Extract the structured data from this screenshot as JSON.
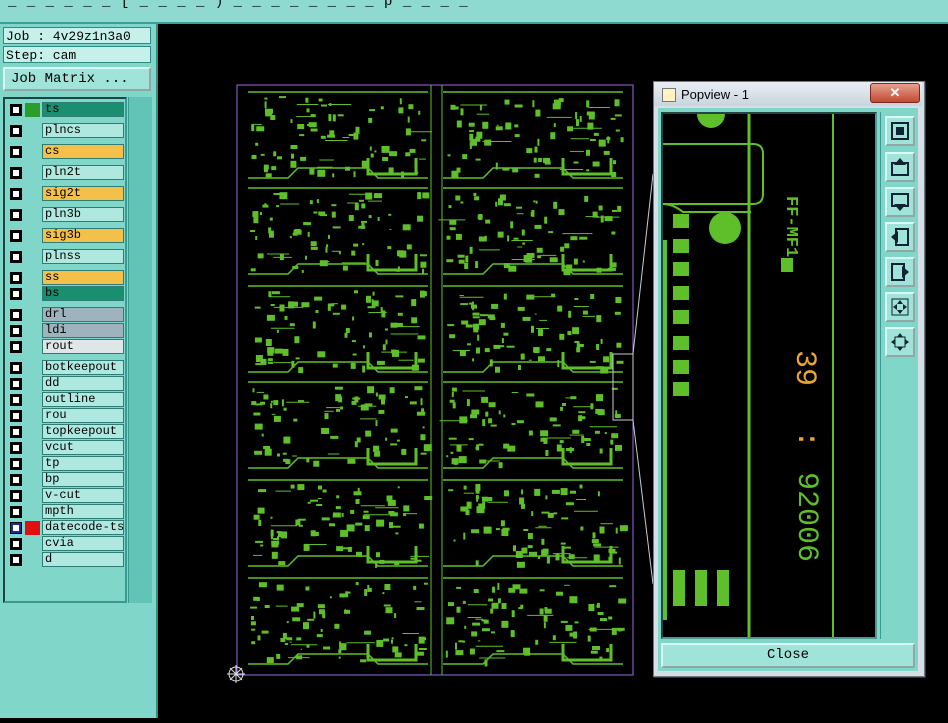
{
  "window": {
    "title": "_ _ _ _ _ _ [ _ _ _ _ ) _ _ _ _ _ _ _ _ p _ _ _ _"
  },
  "job": {
    "job_label": "Job : 4v29z1n3a0",
    "step_label": "Step: cam",
    "matrix_button": "Job Matrix ..."
  },
  "layers": [
    {
      "name": "ts",
      "color": "#1a8f70",
      "swatch": "#2a9d2a",
      "checked": true
    },
    {
      "name": "plncs",
      "color": "#aee8df"
    },
    {
      "name": "cs",
      "color": "#f4c04a"
    },
    {
      "name": "pln2t",
      "color": "#aee8df"
    },
    {
      "name": "sig2t",
      "color": "#f4c04a"
    },
    {
      "name": "pln3b",
      "color": "#aee8df"
    },
    {
      "name": "sig3b",
      "color": "#f4c04a"
    },
    {
      "name": "plnss",
      "color": "#aee8df"
    },
    {
      "name": "ss",
      "color": "#f4c04a"
    },
    {
      "name": "bs",
      "color": "#1a8f70"
    },
    {
      "name": "drl",
      "color": "#9fb3bf"
    },
    {
      "name": "ldi",
      "color": "#9fb3bf"
    },
    {
      "name": "rout",
      "color": "#dfe6e8"
    },
    {
      "name": "botkeepout",
      "color": "#aee8df"
    },
    {
      "name": "dd",
      "color": "#aee8df"
    },
    {
      "name": "outline",
      "color": "#aee8df"
    },
    {
      "name": "rou",
      "color": "#aee8df"
    },
    {
      "name": "topkeepout",
      "color": "#aee8df"
    },
    {
      "name": "vcut",
      "color": "#aee8df"
    },
    {
      "name": "tp",
      "color": "#aee8df"
    },
    {
      "name": "bp",
      "color": "#aee8df"
    },
    {
      "name": "v-cut",
      "color": "#aee8df"
    },
    {
      "name": "mpth",
      "color": "#aee8df"
    },
    {
      "name": "datecode-ts",
      "color": "#aee8df",
      "swatch": "#e01010",
      "selected": true
    },
    {
      "name": "cvia",
      "color": "#aee8df"
    },
    {
      "name": "d",
      "color": "#aee8df"
    }
  ],
  "popview": {
    "title": "Popview - 1",
    "close_x": "✕",
    "close_button": "Close",
    "silk_text_1": "FF-MF1",
    "silk_text_2": "92006",
    "silk_text_3": "39",
    "tool_icons": [
      "fit-icon",
      "pan-up-icon",
      "pan-down-icon",
      "pan-left-icon",
      "pan-right-icon",
      "zoom-in-icon",
      "zoom-out-icon"
    ]
  },
  "colors": {
    "copper": "#5fbf2a",
    "outline": "#9b6be8",
    "panel": "#7fd6c9",
    "highlight": "#e7a533"
  }
}
